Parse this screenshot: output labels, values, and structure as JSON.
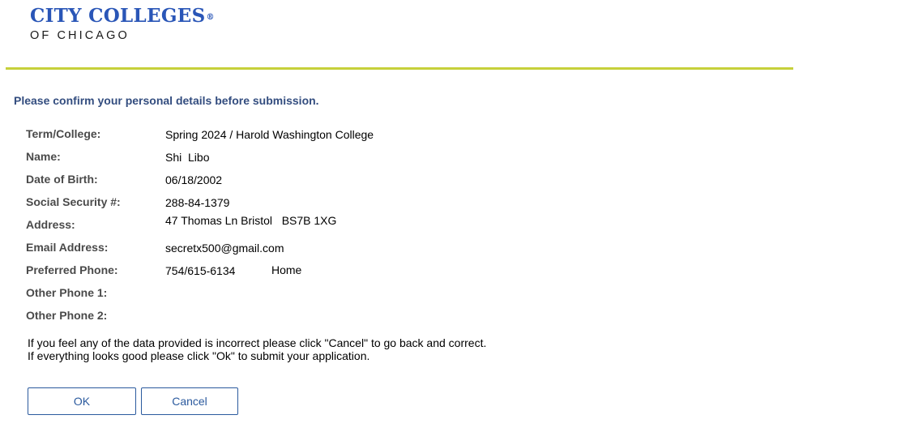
{
  "logo": {
    "line1": "CITY COLLEGES",
    "mark": "®",
    "line2": "OF CHICAGO"
  },
  "heading": "Please confirm your personal details before submission.",
  "details": {
    "term_college": {
      "label": "Term/College:",
      "value": "Spring 2024 / Harold Washington College"
    },
    "name": {
      "label": "Name:",
      "value": "Shi  Libo"
    },
    "dob": {
      "label": "Date of Birth:",
      "value": "06/18/2002"
    },
    "ssn": {
      "label": "Social Security #:",
      "value": "288-84-1379"
    },
    "address": {
      "label": "Address:",
      "value": "47 Thomas Ln Bristol   BS7B 1XG"
    },
    "email": {
      "label": "Email Address:",
      "value": "secretx500@gmail.com"
    },
    "preferred_phone": {
      "label": "Preferred Phone:",
      "value": "754/615-6134",
      "type": "Home"
    },
    "other_phone_1": {
      "label": "Other Phone 1:",
      "value": ""
    },
    "other_phone_2": {
      "label": "Other Phone 2:",
      "value": ""
    }
  },
  "instructions": {
    "line1": "If you feel any of the data provided is incorrect please click \"Cancel\" to go back and correct.",
    "line2": "If everything looks good please click \"Ok\" to submit your application."
  },
  "buttons": {
    "ok": "OK",
    "cancel": "Cancel"
  },
  "colors": {
    "logo_blue": "#2a56b7",
    "rule_green": "#c6d03a",
    "heading_blue": "#334d7f",
    "button_blue": "#2b5a9e"
  }
}
